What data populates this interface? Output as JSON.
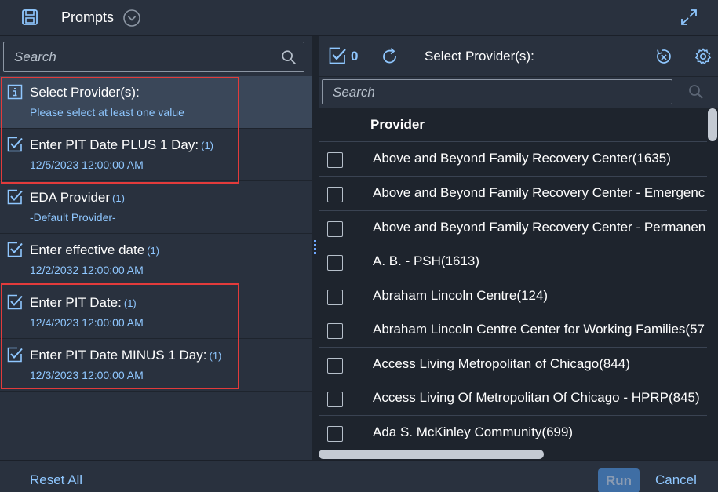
{
  "header": {
    "title": "Prompts"
  },
  "left": {
    "search_placeholder": "Search",
    "prompts": [
      {
        "title": "Select Provider(s):",
        "count": "",
        "subtitle": "Please select at least one value",
        "icon": "info-icon"
      },
      {
        "title": "Enter PIT Date PLUS 1 Day:",
        "count": "(1)",
        "subtitle": "12/5/2023 12:00:00 AM",
        "icon": "checked-icon"
      },
      {
        "title": "EDA Provider",
        "count": "(1)",
        "subtitle": "-Default Provider-",
        "icon": "checked-icon"
      },
      {
        "title": "Enter effective date",
        "count": "(1)",
        "subtitle": "12/2/2032 12:00:00 AM",
        "icon": "checked-icon"
      },
      {
        "title": "Enter PIT Date:",
        "count": "(1)",
        "subtitle": "12/4/2023 12:00:00 AM",
        "icon": "checked-icon"
      },
      {
        "title": "Enter PIT Date MINUS 1 Day:",
        "count": "(1)",
        "subtitle": "12/3/2023 12:00:00 AM",
        "icon": "checked-icon"
      }
    ]
  },
  "right": {
    "selected_count": "0",
    "title": "Select Provider(s):",
    "search_placeholder": "Search",
    "column_header": "Provider",
    "rows": [
      "Above and Beyond Family Recovery Center(1635)",
      "Above and Beyond Family Recovery Center - Emergenc",
      "Above and Beyond Family Recovery Center - Permanen",
      "A. B. - PSH(1613)",
      "Abraham Lincoln Centre(124)",
      "Abraham Lincoln Centre Center for Working Families(57",
      "Access Living Metropolitan of Chicago(844)",
      "Access Living Of Metropolitan Of Chicago - HPRP(845)",
      "Ada S. McKinley Community(699)"
    ]
  },
  "footer": {
    "reset_label": "Reset All",
    "run_label": "Run",
    "cancel_label": "Cancel"
  },
  "colors": {
    "background": "#29313e",
    "table_background": "#1e242d",
    "selected_row": "#3a4759",
    "accent_link": "#8fc7ff",
    "highlight_box": "#e23b3b",
    "run_button": "#3f6ea4"
  }
}
